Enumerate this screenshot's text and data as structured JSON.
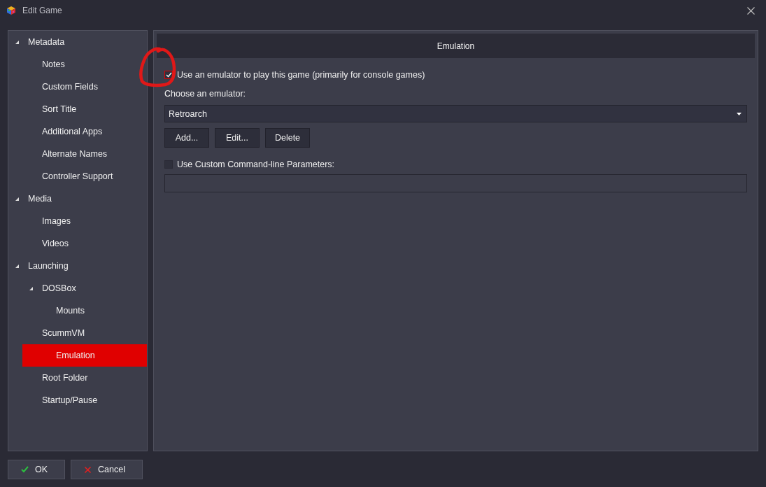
{
  "window": {
    "title": "Edit Game"
  },
  "sidebar": {
    "items": [
      {
        "label": "Metadata",
        "expanded": true,
        "selected": false,
        "children": [
          {
            "label": "Notes",
            "selected": false
          },
          {
            "label": "Custom Fields",
            "selected": false
          },
          {
            "label": "Sort Title",
            "selected": false
          },
          {
            "label": "Additional Apps",
            "selected": false
          },
          {
            "label": "Alternate Names",
            "selected": false
          },
          {
            "label": "Controller Support",
            "selected": false
          }
        ]
      },
      {
        "label": "Media",
        "expanded": true,
        "selected": false,
        "children": [
          {
            "label": "Images",
            "selected": false
          },
          {
            "label": "Videos",
            "selected": false
          }
        ]
      },
      {
        "label": "Launching",
        "expanded": true,
        "selected": false,
        "children": [
          {
            "label": "DOSBox",
            "expanded": true,
            "selected": false,
            "children": [
              {
                "label": "Mounts",
                "selected": false
              }
            ]
          },
          {
            "label": "ScummVM",
            "selected": false
          },
          {
            "label": "Emulation",
            "selected": true
          },
          {
            "label": "Root Folder",
            "selected": false
          },
          {
            "label": "Startup/Pause",
            "selected": false
          }
        ]
      }
    ]
  },
  "panel": {
    "header": "Emulation",
    "use_emulator": {
      "label": "Use an emulator to play this game (primarily for console games)",
      "checked": true
    },
    "emulator_label": "Choose an emulator:",
    "emulator": {
      "value": "Retroarch"
    },
    "buttons": [
      "Add...",
      "Edit...",
      "Delete"
    ],
    "custom_params": {
      "label": "Use Custom Command-line Parameters:",
      "checked": false
    }
  },
  "footer": {
    "buttons": [
      {
        "label": "OK",
        "kind": "ok"
      },
      {
        "label": "Cancel",
        "kind": "cancel"
      }
    ]
  }
}
